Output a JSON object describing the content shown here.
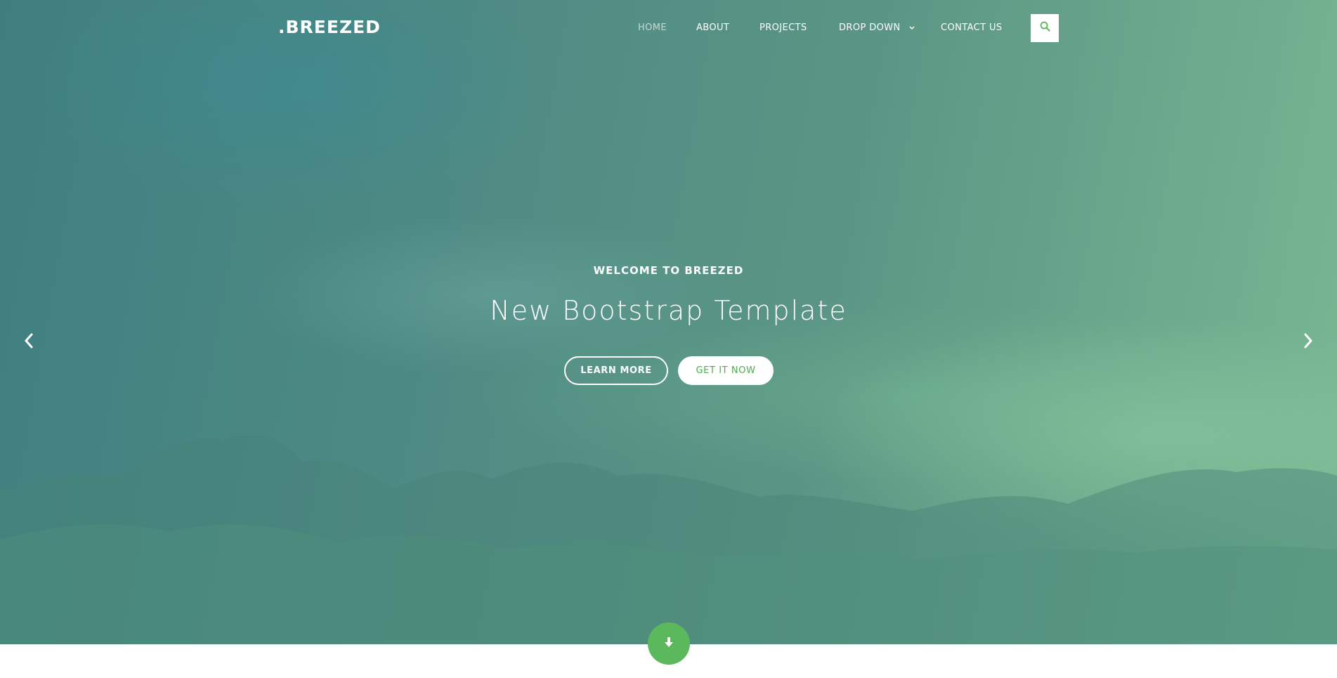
{
  "brand": {
    "logo_text": ".BREEZED"
  },
  "nav": {
    "items": [
      {
        "label": "HOME",
        "active": true
      },
      {
        "label": "ABOUT"
      },
      {
        "label": "PROJECTS"
      },
      {
        "label": "DROP DOWN",
        "icon": "chevron-down-icon"
      },
      {
        "label": "CONTACT US"
      }
    ],
    "search_icon": "search-icon"
  },
  "hero": {
    "eyebrow": "WELCOME TO BREEZED",
    "title": "New Bootstrap Template",
    "buttons": {
      "learn_more": "LEARN MORE",
      "get_it_now": "GET IT NOW"
    },
    "prev_icon": "chevron-left-icon",
    "next_icon": "chevron-right-icon",
    "scroll_icon": "arrow-down-icon"
  },
  "colors": {
    "accent": "#5cb85c",
    "accent_text": "#4cae4c",
    "hero_teal": "#4f8b84",
    "hero_green": "#79b894"
  }
}
